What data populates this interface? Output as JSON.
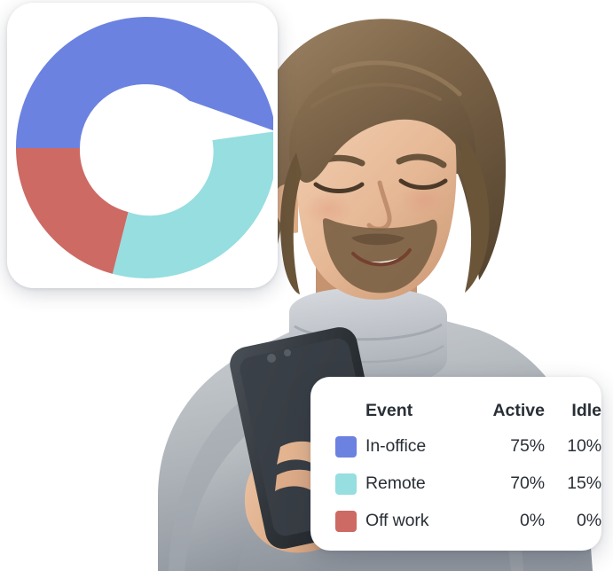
{
  "chart_data": {
    "type": "pie",
    "title": "",
    "subtype": "donut",
    "categories": [
      "In-office",
      "Remote",
      "Off work"
    ],
    "values": [
      48,
      31,
      21
    ],
    "colors": [
      "#6c82e0",
      "#96dee0",
      "#cd6a64"
    ],
    "legend_position": "separate-card",
    "grid": false,
    "table": {
      "columns": [
        "Event",
        "Active",
        "Idle"
      ],
      "rows": [
        {
          "swatch": "#6c82e0",
          "event": "In-office",
          "active": "75%",
          "idle": "10%"
        },
        {
          "swatch": "#96dee0",
          "event": "Remote",
          "active": "70%",
          "idle": "15%"
        },
        {
          "swatch": "#cd6a64",
          "event": "Off work",
          "active": "0%",
          "idle": "0%"
        }
      ]
    }
  },
  "donut_card": {
    "segments": [
      {
        "name": "In-office",
        "color": "#6c82e0",
        "start_deg": 7,
        "end_deg": 180
      },
      {
        "name": "Off work",
        "color": "#cd6a64",
        "start_deg": 180,
        "end_deg": 255
      },
      {
        "name": "Remote",
        "color": "#96dee0",
        "start_deg": 255,
        "end_deg": 367
      }
    ]
  },
  "legend": {
    "headers": {
      "event": "Event",
      "active": "Active",
      "idle": "Idle"
    },
    "rows": [
      {
        "color": "#6c82e0",
        "label": "In-office",
        "active": "75%",
        "idle": "10%"
      },
      {
        "color": "#96dee0",
        "label": "Remote",
        "active": "70%",
        "idle": "15%"
      },
      {
        "color": "#cd6a64",
        "label": "Off work",
        "active": "0%",
        "idle": "0%"
      }
    ]
  },
  "photo": {
    "alt": "Smiling man in gray turtleneck sweater looking at a smartphone",
    "skin": "#e9bb9a",
    "skin_shadow": "#d09e7c",
    "hair": "#7a6046",
    "sweater": "#b9bdc4",
    "phone": "#2e3338"
  }
}
